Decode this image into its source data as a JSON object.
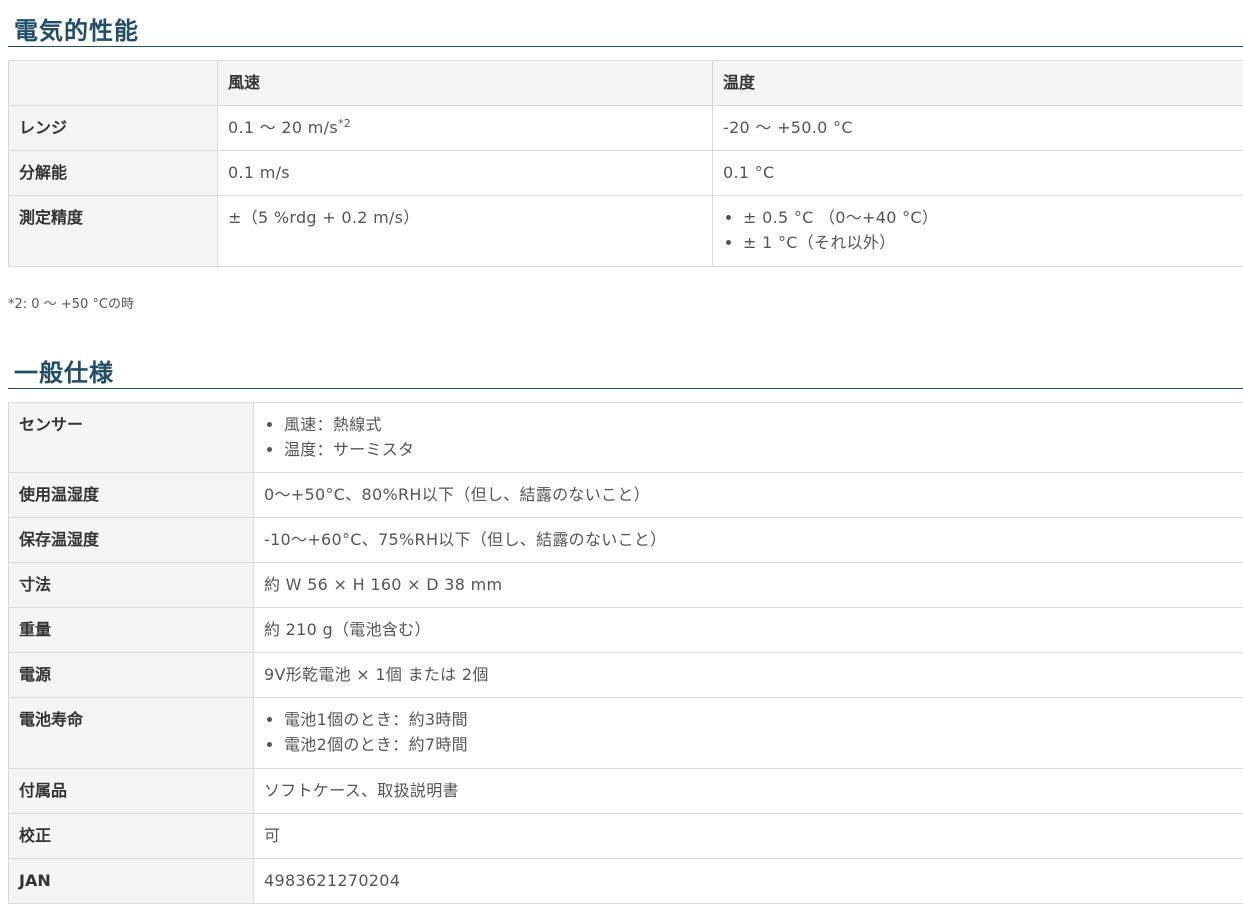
{
  "electrical": {
    "title": "電気的性能",
    "headers": [
      "",
      "風速",
      "温度"
    ],
    "rows": [
      {
        "label": "レンジ",
        "wind": "0.1 〜 20 m/s",
        "wind_sup": "*2",
        "temp": "-20 〜 +50.0 °C"
      },
      {
        "label": "分解能",
        "wind": "0.1 m/s",
        "temp": "0.1 °C"
      },
      {
        "label": "測定精度",
        "wind": "±（5 %rdg + 0.2 m/s）",
        "temp_list": [
          "± 0.5 °C （0〜+40 °C）",
          "± 1 °C（それ以外）"
        ]
      }
    ],
    "footnote": "*2: 0 〜 +50 °Cの時"
  },
  "general": {
    "title": "一般仕様",
    "rows": [
      {
        "label": "センサー",
        "list": [
          "風速：熱線式",
          "温度：サーミスタ"
        ]
      },
      {
        "label": "使用温湿度",
        "value": "0〜+50°C、80%RH以下（但し、結露のないこと）"
      },
      {
        "label": "保存温湿度",
        "value": "-10〜+60°C、75%RH以下（但し、結露のないこと）"
      },
      {
        "label": "寸法",
        "value": "約 W 56 × H 160 × D 38 mm"
      },
      {
        "label": "重量",
        "value": "約 210 g（電池含む）"
      },
      {
        "label": "電源",
        "value": "9V形乾電池 × 1個 または 2個"
      },
      {
        "label": "電池寿命",
        "list": [
          "電池1個のとき：約3時間",
          "電池2個のとき：約7時間"
        ]
      },
      {
        "label": "付属品",
        "value": "ソフトケース、取扱説明書"
      },
      {
        "label": "校正",
        "value": "可"
      },
      {
        "label": "JAN",
        "value": "4983621270204"
      }
    ]
  }
}
